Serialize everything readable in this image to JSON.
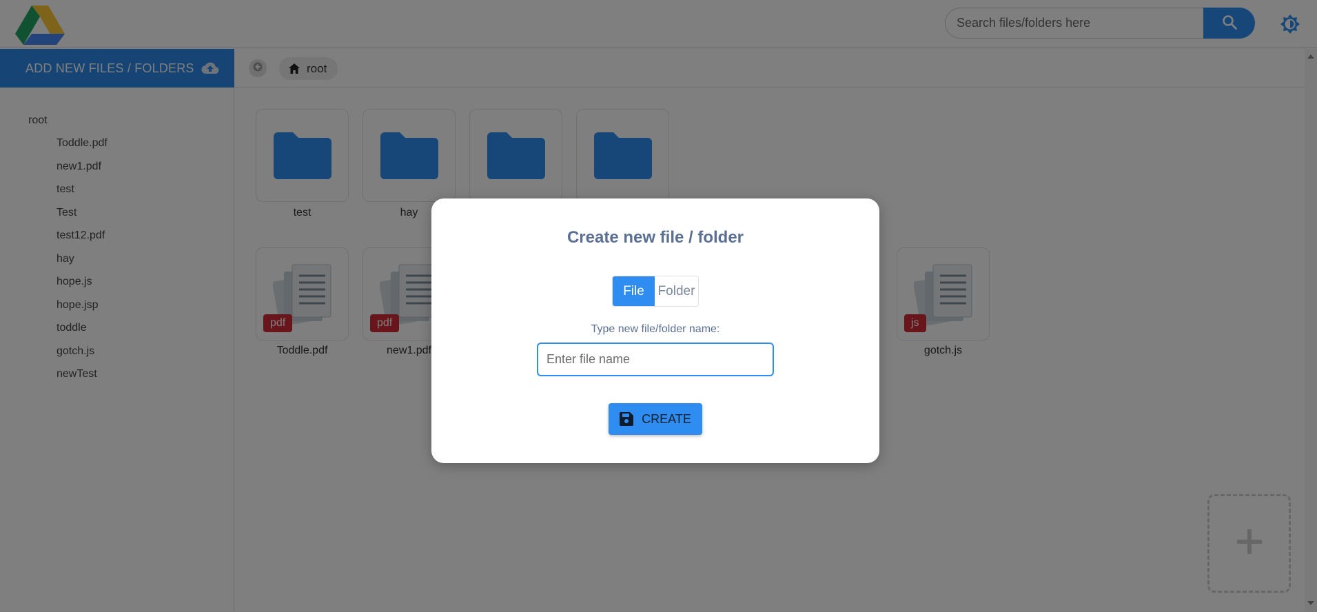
{
  "app": {
    "logo_icon": "google-drive-logo",
    "theme_icon": "brightness-icon"
  },
  "search": {
    "placeholder": "Search files/folders here",
    "value": "",
    "button_icon": "search-icon"
  },
  "sidebar": {
    "add_new_label": "ADD NEW FILES / FOLDERS",
    "add_new_icon": "cloud-upload-icon",
    "tree_root": "root",
    "tree_items": [
      "Toddle.pdf",
      "new1.pdf",
      "test",
      "Test",
      "test12.pdf",
      "hay",
      "hope.js",
      "hope.jsp",
      "toddle",
      "gotch.js",
      "newTest"
    ]
  },
  "breadcrumb": {
    "back_icon": "arrow-left-icon",
    "home_icon": "home-icon",
    "label": "root"
  },
  "folders": [
    {
      "name": "test"
    },
    {
      "name": "hay"
    },
    {
      "name": ""
    },
    {
      "name": ""
    }
  ],
  "files": [
    {
      "name": "Toddle.pdf",
      "ext": "pdf"
    },
    {
      "name": "new1.pdf",
      "ext": "pdf"
    },
    {
      "name": "gotch.js",
      "ext": "js"
    }
  ],
  "fab_icon": "plus-icon",
  "colors": {
    "accent": "#2f8cf0",
    "folder": "#2f8cf0",
    "badge": "#d12b36",
    "modal_title": "#5b6f92"
  },
  "modal": {
    "title": "Create new file / folder",
    "toggle": {
      "options": [
        "File",
        "Folder"
      ],
      "selected": "File"
    },
    "field_label": "Type new file/folder name:",
    "input_placeholder": "Enter file name",
    "input_value": "",
    "create_label": "CREATE",
    "create_icon": "save-icon"
  }
}
